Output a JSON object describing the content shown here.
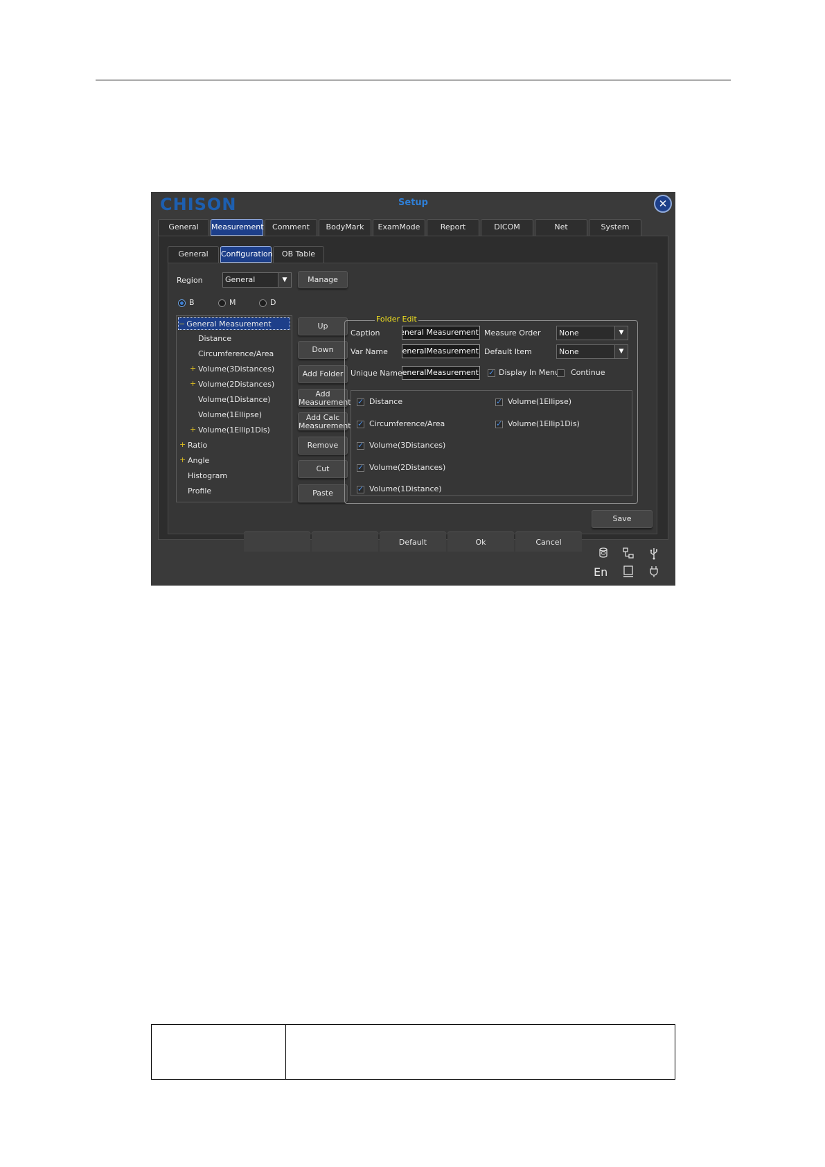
{
  "window": {
    "logo": "CHISON",
    "title": "Setup",
    "close_glyph": "✕"
  },
  "main_tabs": [
    "General",
    "Measurement",
    "Comment",
    "BodyMark",
    "ExamMode",
    "Report",
    "DICOM",
    "Net",
    "System"
  ],
  "main_tab_active": "Measurement",
  "sub_tabs": [
    "General",
    "Configuration",
    "OB Table"
  ],
  "sub_tab_active": "Configuration",
  "region": {
    "label": "Region",
    "value": "General",
    "manage_label": "Manage"
  },
  "modes": {
    "options": [
      "B",
      "M",
      "D"
    ],
    "selected": "B"
  },
  "tree": {
    "items": [
      {
        "label": "General Measurement",
        "prefix": "−",
        "level": 0,
        "selected": true
      },
      {
        "label": "Distance",
        "prefix": "",
        "level": 1
      },
      {
        "label": "Circumference/Area",
        "prefix": "",
        "level": 1
      },
      {
        "label": "Volume(3Distances)",
        "prefix": "+",
        "level": 1
      },
      {
        "label": "Volume(2Distances)",
        "prefix": "+",
        "level": 1
      },
      {
        "label": "Volume(1Distance)",
        "prefix": "",
        "level": 1
      },
      {
        "label": "Volume(1Ellipse)",
        "prefix": "",
        "level": 1
      },
      {
        "label": "Volume(1Ellip1Dis)",
        "prefix": "+",
        "level": 1
      },
      {
        "label": "Ratio",
        "prefix": "+",
        "level": 0
      },
      {
        "label": "Angle",
        "prefix": "+",
        "level": 0
      },
      {
        "label": "Histogram",
        "prefix": "",
        "level": 0
      },
      {
        "label": "Profile",
        "prefix": "",
        "level": 0
      }
    ]
  },
  "actions": {
    "up": "Up",
    "down": "Down",
    "add_folder": "Add Folder",
    "add_measurement_1": "Add",
    "add_measurement_2": "Measurement",
    "add_calc_1": "Add Calc",
    "add_calc_2": "Measurement",
    "remove": "Remove",
    "cut": "Cut",
    "paste": "Paste"
  },
  "folder_edit": {
    "title": "Folder Edit",
    "caption_label": "Caption",
    "caption_value": "General Measurement",
    "var_name_label": "Var Name",
    "var_name_value": "GeneralMeasurement",
    "unique_name_label": "Unique Name",
    "unique_name_value": "GeneralMeasurement",
    "measure_order_label": "Measure Order",
    "measure_order_value": "None",
    "default_item_label": "Default Item",
    "default_item_value": "None",
    "display_in_menu_label": "Display In Menu",
    "display_in_menu_checked": true,
    "continue_label": "Continue",
    "continue_checked": false,
    "items": [
      {
        "label": "Distance",
        "checked": true
      },
      {
        "label": "Circumference/Area",
        "checked": true
      },
      {
        "label": "Volume(3Distances)",
        "checked": true
      },
      {
        "label": "Volume(2Distances)",
        "checked": true
      },
      {
        "label": "Volume(1Distance)",
        "checked": true
      },
      {
        "label": "Volume(1Ellipse)",
        "checked": true
      },
      {
        "label": "Volume(1Ellip1Dis)",
        "checked": true
      }
    ],
    "save_label": "Save"
  },
  "bottom_bar": {
    "default_label": "Default",
    "ok_label": "Ok",
    "cancel_label": "Cancel",
    "language": "En",
    "icons": [
      "storage-icon",
      "network-icon",
      "usb-icon",
      "monitor-icon",
      "power-plug-icon"
    ]
  }
}
